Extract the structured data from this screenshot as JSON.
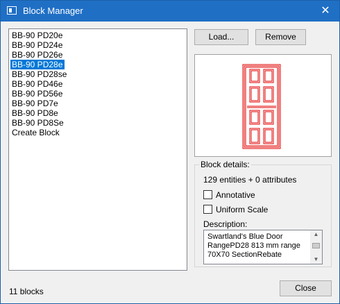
{
  "window": {
    "title": "Block Manager",
    "close_glyph": "✕",
    "icon": "app-icon"
  },
  "blocks": {
    "items": [
      "BB-90 PD20e",
      "BB-90 PD24e",
      "BB-90 PD26e",
      "BB-90 PD28e",
      "BB-90 PD28se",
      "BB-90 PD46e",
      "BB-90 PD56e",
      "BB-90 PD7e",
      "BB-90 PD8e",
      "BB-90 PD8Se",
      "Create Block"
    ],
    "selected": "BB-90 PD28e"
  },
  "buttons": {
    "load_label": "Load...",
    "remove_label": "Remove",
    "close_label": "Close"
  },
  "details": {
    "group_label": "Block details:",
    "entities_text": "129 entities + 0 attributes",
    "annotative_label": "Annotative",
    "annotative_checked": false,
    "uniform_scale_label": "Uniform Scale",
    "uniform_scale_checked": false,
    "description_label": "Description:",
    "description_text": "Swartland's Blue Door\nRangePD28 813 mm range\n70X70 SectionRebate"
  },
  "preview": {
    "line_color": "#e00000"
  },
  "status": {
    "count_text": "11 blocks"
  },
  "colors": {
    "titlebar": "#1f6fc5",
    "selection": "#0078d7"
  }
}
